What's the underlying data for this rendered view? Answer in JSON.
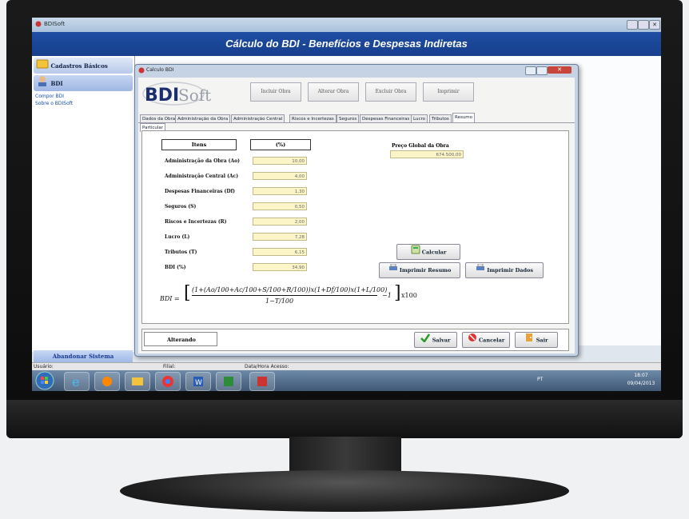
{
  "app": {
    "window_title": "BDISoft",
    "header_title": "Cálculo do BDI - Benefícios e Despesas Indiretas"
  },
  "sidebar": {
    "group1_label": "Cadastros Básicos",
    "group2_label": "BDI",
    "links": [
      "Compor BDI",
      "Sobre o BDISoft"
    ],
    "abandon_label": "Abandonar Sistema"
  },
  "statusbar": {
    "usuario_label": "Usuário:",
    "filial_label": "Filial:",
    "datahora_label": "Data/Hora Acesso:"
  },
  "dialog": {
    "title": "Calculo BDI",
    "logo_text": "BDISoft",
    "toolbar": {
      "incluir": "Incluir Obra",
      "alterar": "Alterar Obra",
      "excluir": "Excluir Obra",
      "imprimir": "Imprimir"
    },
    "tabs": [
      "Dados da Obra",
      "Administração da Obra",
      "Administração Central",
      "Riscos e Incertezas",
      "Seguros",
      "Despesas Financeiras",
      "Lucro",
      "Tributos",
      "Resumo"
    ],
    "subtab": "Particular",
    "table": {
      "col_items": "Itens",
      "col_pct": "(%)",
      "rows": [
        {
          "label": "Administração da Obra (Ao)",
          "value": "10,00"
        },
        {
          "label": "Administração Central (Ac)",
          "value": "4,00"
        },
        {
          "label": "Despesas Financeiras (Df)",
          "value": "1,30"
        },
        {
          "label": "Seguros (S)",
          "value": "0,50"
        },
        {
          "label": "Riscos e Incertezas (R)",
          "value": "2,00"
        },
        {
          "label": "Lucro (L)",
          "value": "7,28"
        },
        {
          "label": "Tributos (T)",
          "value": "6,15"
        },
        {
          "label": "BDI (%)",
          "value": "34,90"
        }
      ]
    },
    "preco_label": "Preço Global da Obra",
    "preco_value": "674.500,00",
    "calcular": "Calcular",
    "imprimir_resumo": "Imprimir Resumo",
    "imprimir_dados": "Imprimir Dados",
    "formula_lhs": "BDI =",
    "formula_num": "(1+(Ao/100+Ac/100+S/100+R/100))x(1+Df/100)x(1+L/100)",
    "formula_den": "1−T/100",
    "formula_minus": "−1",
    "formula_tail": "x100",
    "status_text": "Alterando",
    "salvar": "Salvar",
    "cancelar": "Cancelar",
    "sair": "Sair"
  },
  "taskbar": {
    "lang": "PT",
    "time": "18:07",
    "date": "09/04/2013"
  },
  "colors": {
    "header_blue": "#1f4ea3",
    "field_yellow": "#fbf5c8"
  }
}
